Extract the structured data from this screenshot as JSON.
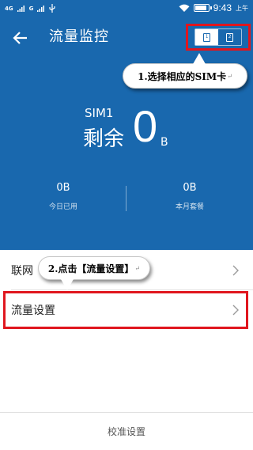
{
  "status_bar": {
    "signal_1": "4G",
    "signal_2": "G",
    "time": "9:43",
    "ampm": "上午",
    "battery_level": 0.8
  },
  "header": {
    "title": "流量监控",
    "sim_options": [
      "1",
      "2"
    ],
    "selected_sim": "1"
  },
  "summary": {
    "sim_name": "SIM1",
    "remain_label": "剩余",
    "remain_value": "0",
    "remain_unit": "B",
    "today_value": "0B",
    "today_label": "今日已用",
    "month_value": "0B",
    "month_label": "本月套餐"
  },
  "list": {
    "row1_label": "联网",
    "row2_label": "流量设置"
  },
  "footer": {
    "calibrate_label": "校准设置"
  },
  "annotations": {
    "step1": "1.选择相应的SIM卡",
    "step2": "2.点击【流量设置】",
    "para_mark": "↵"
  },
  "colors": {
    "header_bg": "#1968ae",
    "highlight": "#e0161e"
  }
}
